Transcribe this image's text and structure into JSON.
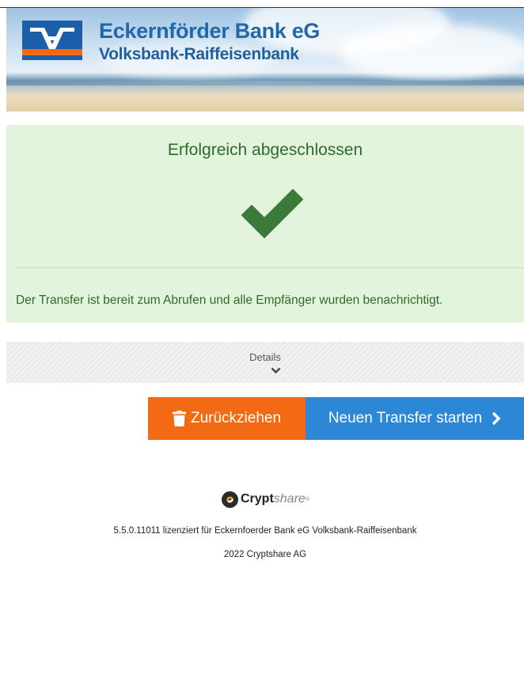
{
  "header": {
    "bank_name": "Eckernförder Bank eG",
    "bank_subtitle": "Volksbank-Raiffeisenbank",
    "logo_icon": "volksbank-raiffeisenbank-logo",
    "colors": {
      "logo_blue": "#1d5ea8",
      "logo_orange": "#f26a13",
      "name_blue": "#2268a8"
    }
  },
  "status": {
    "title": "Erfolgreich abgeschlossen",
    "icon": "checkmark-icon",
    "message": "Der Transfer ist bereit zum Abrufen und alle Empfänger wurden benachrichtigt.",
    "colors": {
      "background": "#e3f4dc",
      "text": "#2e6a2e",
      "check": "#3b7a3b"
    }
  },
  "details": {
    "label": "Details",
    "icon": "chevron-down-icon"
  },
  "actions": {
    "withdraw_label": "Zurückziehen",
    "withdraw_icon": "trash-icon",
    "new_transfer_label": "Neuen Transfer starten",
    "new_transfer_icon": "chevron-right-icon",
    "colors": {
      "withdraw": "#f26a13",
      "new_transfer": "#2c88d6"
    }
  },
  "footer": {
    "brand_bold": "Crypt",
    "brand_light": "share",
    "brand_tm": "®",
    "license": "5.5.0.11011 lizenziert für Eckernfoerder Bank eG Volksbank-Raiffeisenbank",
    "copyright": "2022 Cryptshare AG"
  }
}
